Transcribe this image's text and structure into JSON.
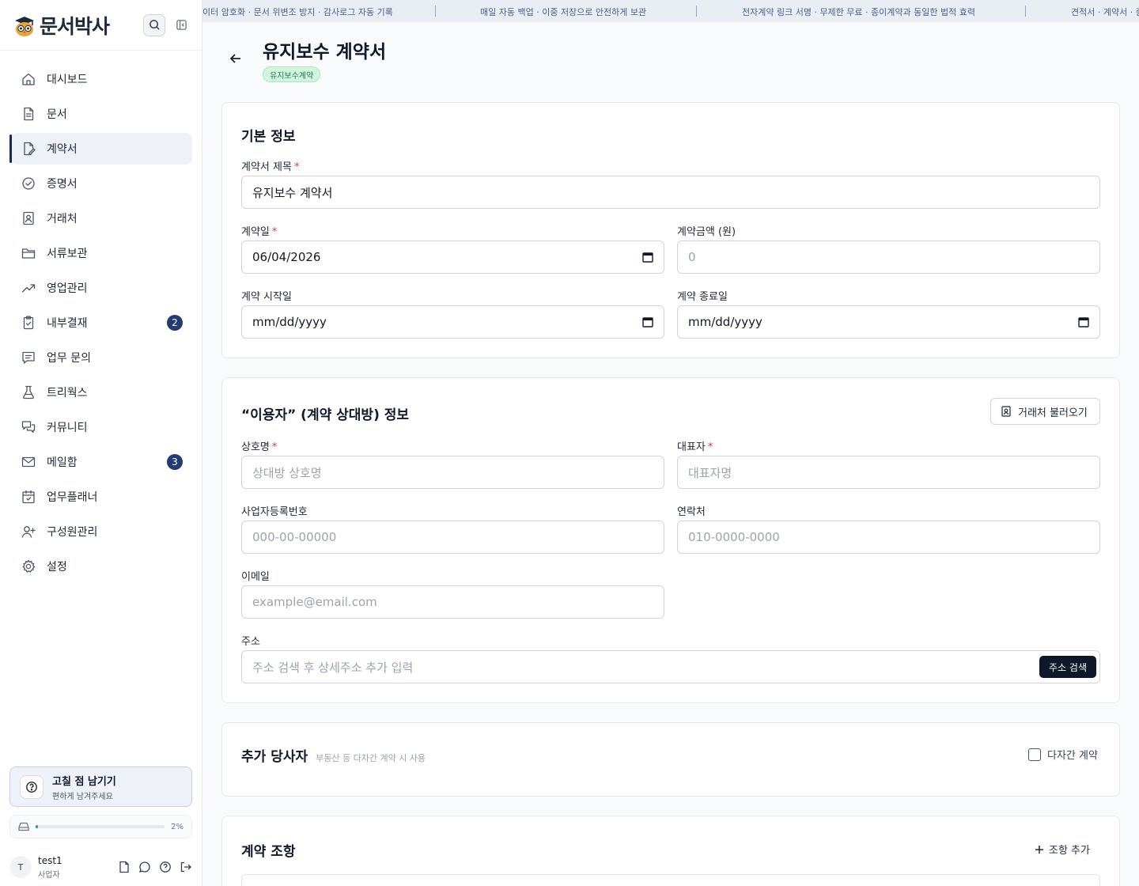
{
  "app": {
    "logo_text": "문서박사"
  },
  "sidebar": {
    "items": [
      {
        "label": "대시보드",
        "icon": "home-icon"
      },
      {
        "label": "문서",
        "icon": "document-icon"
      },
      {
        "label": "계약서",
        "icon": "contract-edit-icon",
        "active": true
      },
      {
        "label": "증명서",
        "icon": "certificate-check-icon"
      },
      {
        "label": "거래처",
        "icon": "contact-book-icon"
      },
      {
        "label": "서류보관",
        "icon": "folder-icon"
      },
      {
        "label": "영업관리",
        "icon": "trending-up-icon"
      },
      {
        "label": "내부결재",
        "icon": "clipboard-check-icon",
        "badge": "2"
      },
      {
        "label": "업무 문의",
        "icon": "message-square-icon"
      },
      {
        "label": "트리웍스",
        "icon": "flask-icon"
      },
      {
        "label": "커뮤니티",
        "icon": "chat-bubbles-icon"
      },
      {
        "label": "메일함",
        "icon": "mail-icon",
        "badge": "3"
      },
      {
        "label": "업무플래너",
        "icon": "calendar-check-icon"
      },
      {
        "label": "구성원관리",
        "icon": "user-plus-icon"
      },
      {
        "label": "설정",
        "icon": "gear-icon"
      }
    ],
    "feedback": {
      "title": "고칠 점 남기기",
      "subtitle": "편하게 남겨주세요"
    },
    "storage": {
      "percent_label": "2%",
      "percent": 2
    },
    "user": {
      "initial": "T",
      "name": "test1",
      "role": "사업자"
    }
  },
  "ticker": {
    "items": [
      "이터 암호화 · 문서 위변조 방지 · 감사로그 자동 기록",
      "매일 자동 백업 · 이중 저장으로 안전하게 보관",
      "전자계약 링크 서명 · 무제한 무료 · 종이계약과 동일한 법적 효력",
      "견적서 · 계약서 · 증"
    ]
  },
  "page": {
    "title": "유지보수 계약서",
    "type_badge": "유지보수계약"
  },
  "basic_info": {
    "title": "기본 정보",
    "contract_title_label": "계약서 제목",
    "contract_title_value": "유지보수 계약서",
    "contract_date_label": "계약일",
    "contract_date_value": "06/04/2026",
    "amount_label": "계약금액 (원)",
    "amount_placeholder": "0",
    "start_date_label": "계약 시작일",
    "start_date_placeholder": "mm/dd/yyyy",
    "end_date_label": "계약 종료일",
    "end_date_placeholder": "mm/dd/yyyy"
  },
  "counterparty": {
    "title": "“이용자” (계약 상대방) 정보",
    "import_button": "거래처 불러오기",
    "company_label": "상호명",
    "company_placeholder": "상대방 상호명",
    "rep_label": "대표자",
    "rep_placeholder": "대표자명",
    "bizno_label": "사업자등록번호",
    "bizno_placeholder": "000-00-00000",
    "phone_label": "연락처",
    "phone_placeholder": "010-0000-0000",
    "email_label": "이메일",
    "email_placeholder": "example@email.com",
    "address_label": "주소",
    "address_placeholder": "주소 검색 후 상세주소 추가 입력",
    "address_search_button": "주소 검색"
  },
  "extra_parties": {
    "title": "추가 당사자",
    "hint": "부동산 등 다자간 계약 시 사용",
    "checkbox_label": "다자간 계약"
  },
  "clauses": {
    "title": "계약 조항",
    "add_button": "조항 추가"
  },
  "colors": {
    "primary": "#1e2a52",
    "badge": "#243a73",
    "required": "#e0344a",
    "success_bg": "#d3f5df",
    "success_text": "#18794e"
  }
}
